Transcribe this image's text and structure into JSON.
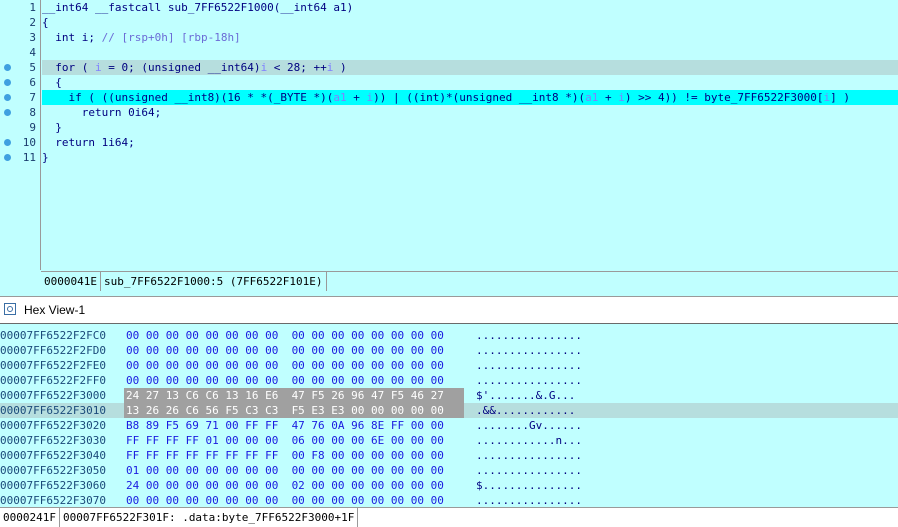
{
  "pseudocode": {
    "lines": [
      {
        "num": "1",
        "breakpoint": false,
        "highlight": "none",
        "tokens": [
          [
            "kw",
            "__int64 __fastcall sub_7FF6522F1000(__int64 a1)"
          ]
        ]
      },
      {
        "num": "2",
        "breakpoint": false,
        "highlight": "none",
        "tokens": [
          [
            "kw",
            "{"
          ]
        ]
      },
      {
        "num": "3",
        "breakpoint": false,
        "highlight": "none",
        "tokens": [
          [
            "kw",
            "  int i; "
          ],
          [
            "cmt",
            "// [rsp+0h] [rbp-18h]"
          ]
        ]
      },
      {
        "num": "4",
        "breakpoint": false,
        "highlight": "none",
        "tokens": [
          [
            "kw",
            ""
          ]
        ]
      },
      {
        "num": "5",
        "breakpoint": true,
        "highlight": "gray",
        "tokens": [
          [
            "kw",
            "  for ( "
          ],
          [
            "var",
            "i"
          ],
          [
            "kw",
            " = 0; (unsigned __int64)"
          ],
          [
            "var",
            "i"
          ],
          [
            "kw",
            " < 28; ++"
          ],
          [
            "var",
            "i"
          ],
          [
            "kw",
            " )"
          ]
        ]
      },
      {
        "num": "6",
        "breakpoint": true,
        "highlight": "none",
        "tokens": [
          [
            "kw",
            "  {"
          ]
        ]
      },
      {
        "num": "7",
        "breakpoint": true,
        "highlight": "cyan",
        "tokens": [
          [
            "kw",
            "    if ( ((unsigned __int8)(16 * *(_BYTE *)("
          ],
          [
            "var",
            "a1"
          ],
          [
            "kw",
            " + "
          ],
          [
            "var",
            "i"
          ],
          [
            "kw",
            ")) | ((int)*(unsigned __int8 *)("
          ],
          [
            "var",
            "a1"
          ],
          [
            "kw",
            " + "
          ],
          [
            "var",
            "i"
          ],
          [
            "kw",
            ") >> 4)) != byte_7FF6522F3000["
          ],
          [
            "var",
            "i"
          ],
          [
            "kw",
            "] )"
          ]
        ]
      },
      {
        "num": "8",
        "breakpoint": true,
        "highlight": "none",
        "tokens": [
          [
            "kw",
            "      return 0i64;"
          ]
        ]
      },
      {
        "num": "9",
        "breakpoint": false,
        "highlight": "none",
        "tokens": [
          [
            "kw",
            "  }"
          ]
        ]
      },
      {
        "num": "10",
        "breakpoint": true,
        "highlight": "none",
        "tokens": [
          [
            "kw",
            "  return 1i64;"
          ]
        ]
      },
      {
        "num": "11",
        "breakpoint": true,
        "highlight": "none",
        "tokens": [
          [
            "kw",
            "}"
          ]
        ]
      }
    ],
    "status": {
      "offset": "0000041E",
      "location": "sub_7FF6522F1000:5 (7FF6522F101E)"
    }
  },
  "hex_view": {
    "title": "Hex View-1",
    "icon": "hex-view-icon",
    "rows": [
      {
        "addr": "00007FF6522F2FC0",
        "bytes": "00 00 00 00 00 00 00 00  00 00 00 00 00 00 00 00",
        "ascii": "................",
        "selected": false,
        "row_hl": false
      },
      {
        "addr": "00007FF6522F2FD0",
        "bytes": "00 00 00 00 00 00 00 00  00 00 00 00 00 00 00 00",
        "ascii": "................",
        "selected": false,
        "row_hl": false
      },
      {
        "addr": "00007FF6522F2FE0",
        "bytes": "00 00 00 00 00 00 00 00  00 00 00 00 00 00 00 00",
        "ascii": "................",
        "selected": false,
        "row_hl": false
      },
      {
        "addr": "00007FF6522F2FF0",
        "bytes": "00 00 00 00 00 00 00 00  00 00 00 00 00 00 00 00",
        "ascii": "................",
        "selected": false,
        "row_hl": false
      },
      {
        "addr": "00007FF6522F3000",
        "bytes": "24 27 13 C6 C6 13 16 E6  47 F5 26 96 47 F5 46 27",
        "ascii": "$'.......&.G...",
        "selected": true,
        "row_hl": false
      },
      {
        "addr": "00007FF6522F3010",
        "bytes": "13 26 26 C6 56 F5 C3 C3  F5 E3 E3 00 00 00 00 00",
        "ascii": ".&&............",
        "selected": true,
        "row_hl": true
      },
      {
        "addr": "00007FF6522F3020",
        "bytes": "B8 89 F5 69 71 00 FF FF  47 76 0A 96 8E FF 00 00",
        "ascii": "........Gv......",
        "selected": false,
        "row_hl": false
      },
      {
        "addr": "00007FF6522F3030",
        "bytes": "FF FF FF FF 01 00 00 00  06 00 00 00 6E 00 00 00",
        "ascii": "............n...",
        "selected": false,
        "row_hl": false
      },
      {
        "addr": "00007FF6522F3040",
        "bytes": "FF FF FF FF FF FF FF FF  00 F8 00 00 00 00 00 00",
        "ascii": "................",
        "selected": false,
        "row_hl": false
      },
      {
        "addr": "00007FF6522F3050",
        "bytes": "01 00 00 00 00 00 00 00  00 00 00 00 00 00 00 00",
        "ascii": "................",
        "selected": false,
        "row_hl": false
      },
      {
        "addr": "00007FF6522F3060",
        "bytes": "24 00 00 00 00 00 00 00  02 00 00 00 00 00 00 00",
        "ascii": "$...............",
        "selected": false,
        "row_hl": false
      },
      {
        "addr": "00007FF6522F3070",
        "bytes": "00 00 00 00 00 00 00 00  00 00 00 00 00 00 00 00",
        "ascii": "................",
        "selected": false,
        "row_hl": false
      }
    ],
    "status": {
      "offset": "0000241F",
      "location": "00007FF6522F301F: .data:byte_7FF6522F3000+1F"
    }
  },
  "colors": {
    "background": "#c0ffff",
    "line_highlight": "#00ffff",
    "selection": "#a0a0a0",
    "keyword": "#000080",
    "variable": "#8080ff"
  }
}
